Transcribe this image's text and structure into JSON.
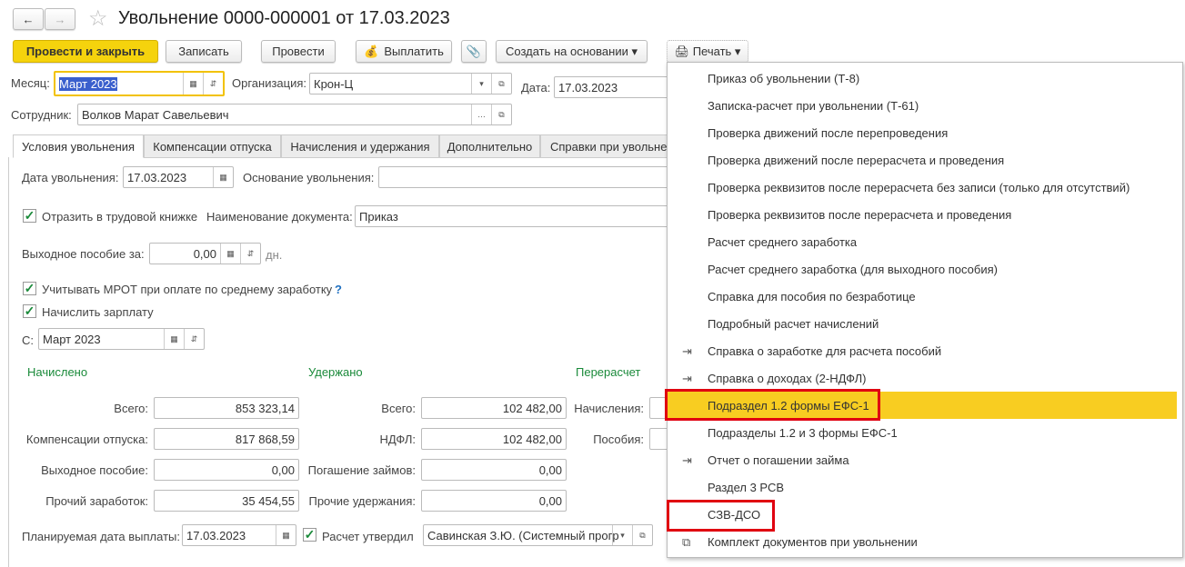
{
  "title": "Увольнение 0000-000001 от 17.03.2023",
  "toolbar": {
    "post_close": "Провести и закрыть",
    "save": "Записать",
    "post": "Провести",
    "pay": "Выплатить",
    "create_based": "Создать на основании",
    "print": "Печать"
  },
  "header": {
    "month_label": "Месяц:",
    "month_value": "Март 2023",
    "org_label": "Организация:",
    "org_value": "Крон-Ц",
    "date_label": "Дата:",
    "date_value": "17.03.2023",
    "employee_label": "Сотрудник:",
    "employee_value": "Волков Марат Савельевич"
  },
  "tabs": [
    "Условия увольнения",
    "Компенсации отпуска",
    "Начисления и удержания",
    "Дополнительно",
    "Справки при увольне"
  ],
  "form": {
    "dismissal_date_label": "Дата увольнения:",
    "dismissal_date": "17.03.2023",
    "basis_label": "Основание увольнения:",
    "workbook_label": "Отразить в трудовой книжке",
    "doc_name_label": "Наименование документа:",
    "doc_name": "Приказ",
    "severance_label": "Выходное пособие за:",
    "severance_value": "0,00",
    "severance_unit": "дн.",
    "mrot_label": "Учитывать МРОТ при оплате по среднему заработку",
    "help": "?",
    "accrue_label": "Начислить зарплату",
    "from_label": "С:",
    "from_value": "Март 2023"
  },
  "accrued": {
    "title": "Начислено",
    "rows": [
      {
        "label": "Всего:",
        "value": "853 323,14"
      },
      {
        "label": "Компенсации отпуска:",
        "value": "817 868,59"
      },
      {
        "label": "Выходное пособие:",
        "value": "0,00"
      },
      {
        "label": "Прочий заработок:",
        "value": "35 454,55"
      }
    ]
  },
  "withheld": {
    "title": "Удержано",
    "rows": [
      {
        "label": "Всего:",
        "value": "102 482,00"
      },
      {
        "label": "НДФЛ:",
        "value": "102 482,00"
      },
      {
        "label": "Погашение займов:",
        "value": "0,00"
      },
      {
        "label": "Прочие удержания:",
        "value": "0,00"
      }
    ]
  },
  "recalc": {
    "title": "Перерасчет",
    "rows": [
      {
        "label": "Начисления:"
      },
      {
        "label": "Пособия:"
      }
    ]
  },
  "footer": {
    "pay_date_label": "Планируемая дата выплаты:",
    "pay_date": "17.03.2023",
    "approved_label": "Расчет утвердил",
    "approved_value": "Савинская З.Ю. (Системный прогр"
  },
  "print_menu": [
    "Приказ об увольнении (Т-8)",
    "Записка-расчет при увольнении (Т-61)",
    "Проверка движений после перепроведения",
    "Проверка движений после перерасчета и проведения",
    "Проверка реквизитов после перерасчета без записи (только для отсутствий)",
    "Проверка реквизитов после перерасчета и проведения",
    "Расчет среднего заработка",
    "Расчет среднего заработка (для выходного пособия)",
    "Справка для пособия по безработице",
    "Подробный расчет начислений",
    "Справка о заработке для расчета пособий",
    "Справка о доходах (2-НДФЛ)",
    "Подраздел 1.2 формы ЕФС-1",
    "Подразделы 1.2 и 3 формы ЕФС-1",
    "Отчет о погашении займа",
    "Раздел 3 РСВ",
    "СЗВ-ДСО",
    "Комплект документов при увольнении"
  ],
  "colors": {
    "accent": "#f5d30d",
    "highlight": "#f8cd21",
    "group_title": "#1a8a3a",
    "annotation": "#e00010"
  }
}
